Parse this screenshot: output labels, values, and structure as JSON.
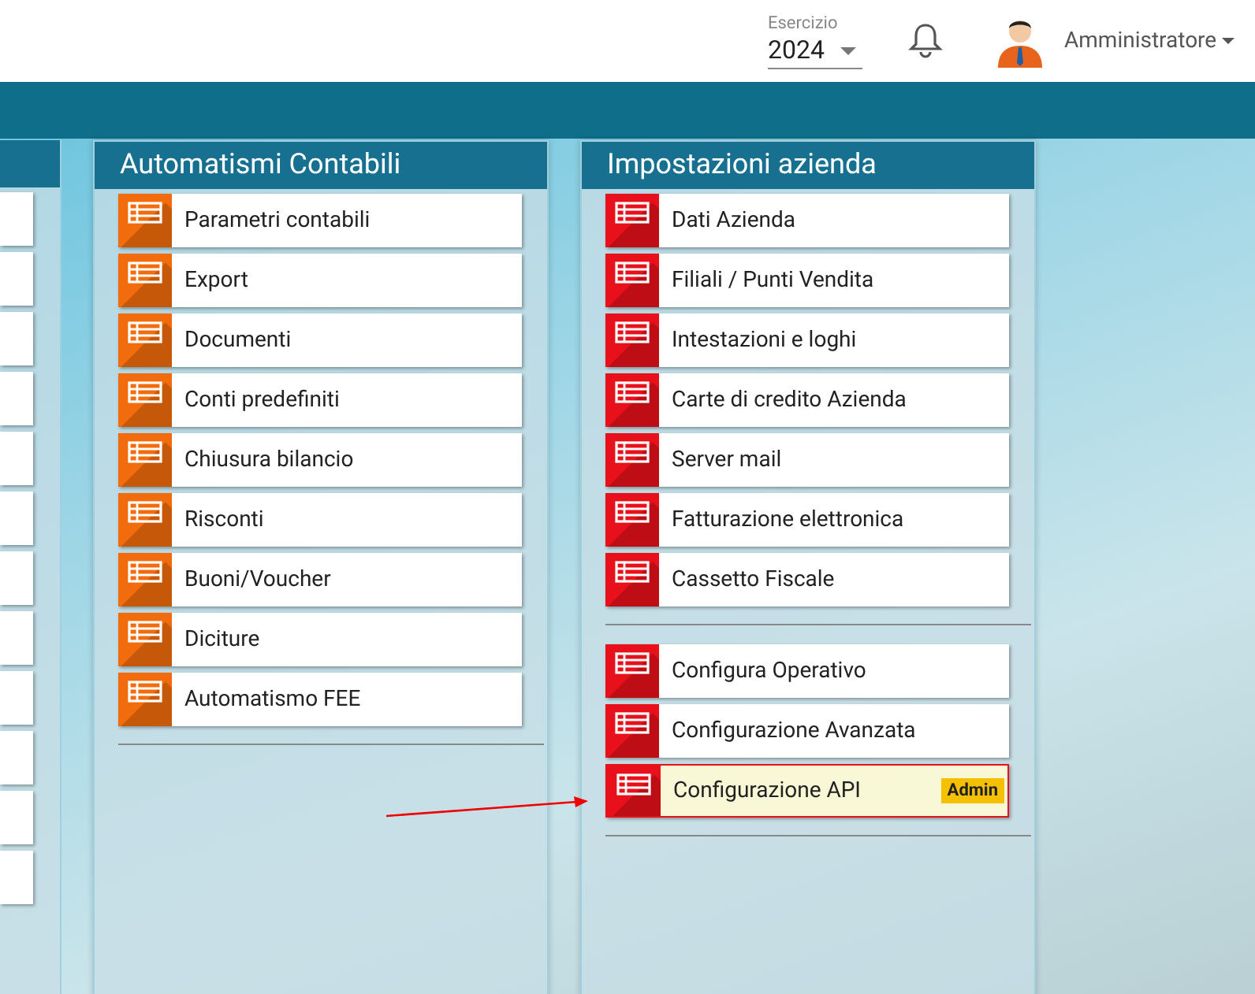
{
  "header": {
    "year_selector": {
      "label": "Esercizio",
      "value": "2024"
    },
    "user": {
      "name": "Amministratore"
    }
  },
  "panels": [
    {
      "title": "Automatismi Contabili",
      "color": "#f26c0d",
      "groups": [
        [
          {
            "label": "Parametri contabili",
            "highlighted": false
          },
          {
            "label": "Export",
            "highlighted": false
          },
          {
            "label": "Documenti",
            "highlighted": false
          },
          {
            "label": "Conti predefiniti",
            "highlighted": false
          },
          {
            "label": "Chiusura bilancio",
            "highlighted": false
          },
          {
            "label": "Risconti",
            "highlighted": false
          },
          {
            "label": "Buoni/Voucher",
            "highlighted": false
          },
          {
            "label": "Diciture",
            "highlighted": false
          },
          {
            "label": "Automatismo FEE",
            "highlighted": false
          }
        ]
      ]
    },
    {
      "title": "Impostazioni azienda",
      "color": "#e8101a",
      "groups": [
        [
          {
            "label": "Dati Azienda",
            "highlighted": false
          },
          {
            "label": "Filiali / Punti Vendita",
            "highlighted": false
          },
          {
            "label": "Intestazioni e loghi",
            "highlighted": false
          },
          {
            "label": "Carte di credito Azienda",
            "highlighted": false
          },
          {
            "label": "Server mail",
            "highlighted": false
          },
          {
            "label": "Fatturazione elettronica",
            "highlighted": false
          },
          {
            "label": "Cassetto Fiscale",
            "highlighted": false
          }
        ],
        [
          {
            "label": "Configura Operativo",
            "highlighted": false
          },
          {
            "label": "Configurazione Avanzata",
            "highlighted": false
          },
          {
            "label": "Configurazione API",
            "highlighted": true,
            "badge": "Admin"
          }
        ]
      ]
    }
  ]
}
